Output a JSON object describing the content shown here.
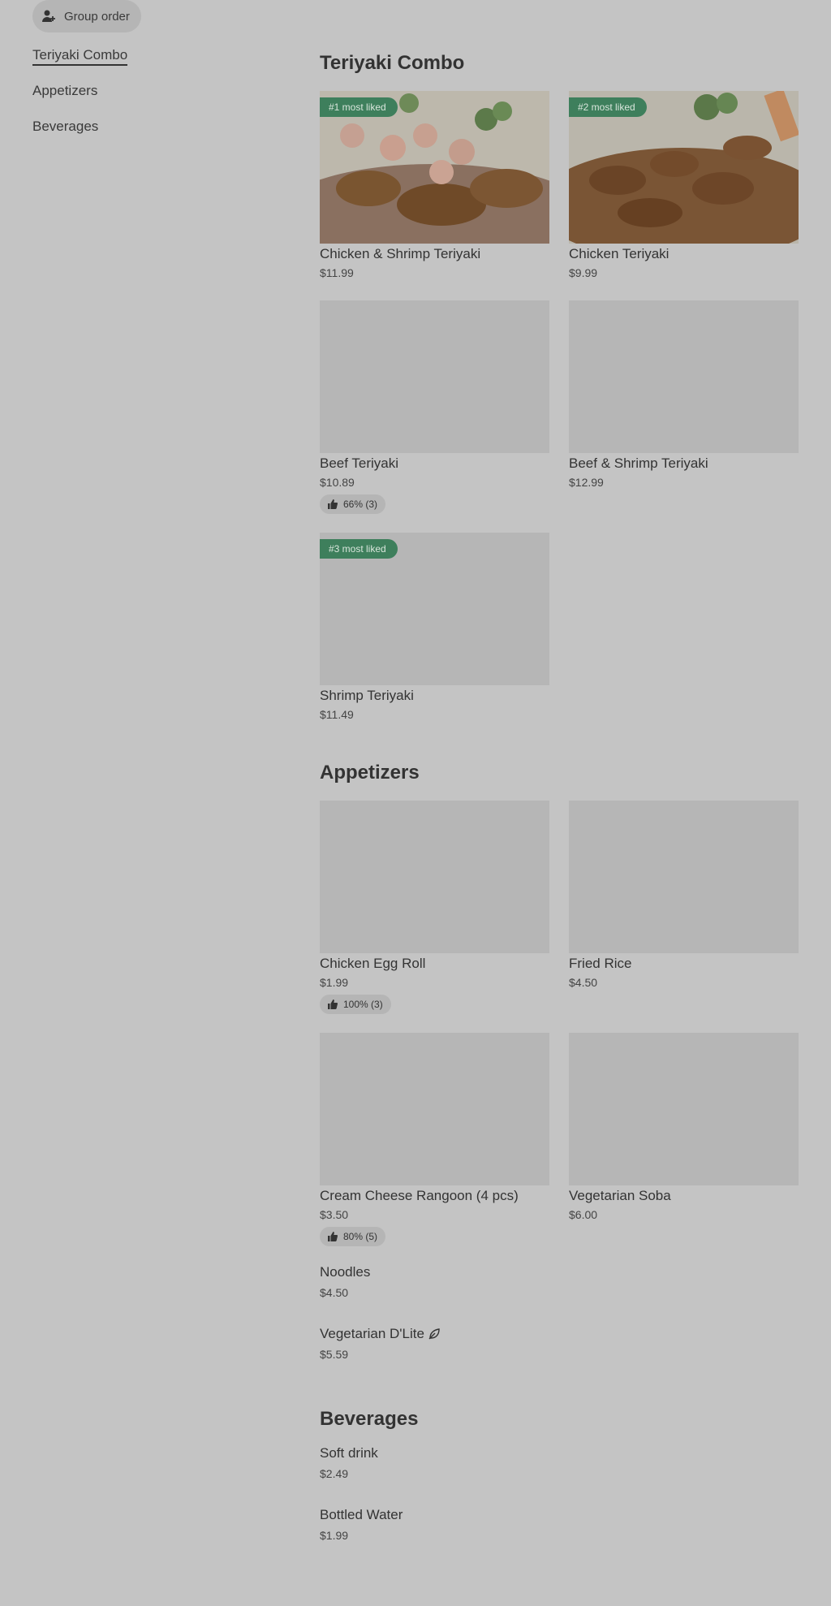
{
  "header": {
    "group_order_label": "Group order"
  },
  "sidebar": {
    "items": [
      {
        "label": "Teriyaki Combo",
        "active": true
      },
      {
        "label": "Appetizers",
        "active": false
      },
      {
        "label": "Beverages",
        "active": false
      }
    ]
  },
  "sections": {
    "teriyaki": {
      "title": "Teriyaki Combo",
      "items": [
        {
          "name": "Chicken & Shrimp Teriyaki",
          "price": "$11.99",
          "badge": "#1 most liked"
        },
        {
          "name": "Chicken Teriyaki",
          "price": "$9.99",
          "badge": "#2 most liked"
        },
        {
          "name": "Beef Teriyaki",
          "price": "$10.89",
          "likes": "66% (3)"
        },
        {
          "name": "Beef & Shrimp Teriyaki",
          "price": "$12.99"
        },
        {
          "name": "Shrimp Teriyaki",
          "price": "$11.49",
          "badge": "#3 most liked"
        }
      ]
    },
    "appetizers": {
      "title": "Appetizers",
      "items": [
        {
          "name": "Chicken Egg Roll",
          "price": "$1.99",
          "likes": "100% (3)"
        },
        {
          "name": "Fried Rice",
          "price": "$4.50"
        },
        {
          "name": "Cream Cheese Rangoon (4 pcs)",
          "price": "$3.50",
          "likes": "80% (5)"
        },
        {
          "name": "Vegetarian Soba",
          "price": "$6.00"
        },
        {
          "name": "Noodles",
          "price": "$4.50"
        },
        {
          "name": "Vegetarian D'Lite",
          "price": "$5.59",
          "icon": "leaf-icon"
        }
      ]
    },
    "beverages": {
      "title": "Beverages",
      "items": [
        {
          "name": "Soft drink",
          "price": "$2.49"
        },
        {
          "name": "Bottled Water",
          "price": "$1.99"
        }
      ]
    }
  },
  "colors": {
    "background": "#c4c4c4",
    "badge": "#3e7f5c",
    "placeholder": "#b6b6b6"
  }
}
